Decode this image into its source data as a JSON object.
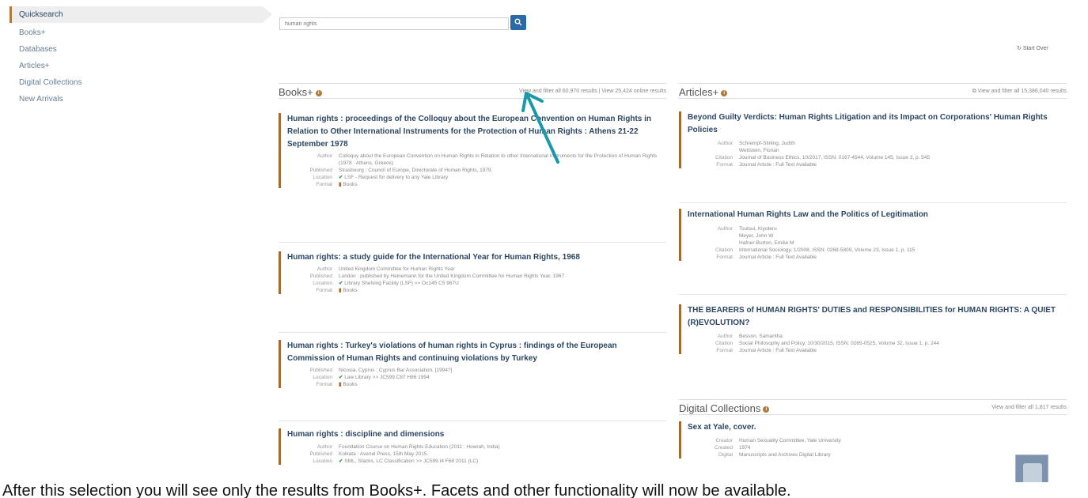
{
  "sidebar": {
    "items": [
      {
        "label": "Quicksearch"
      },
      {
        "label": "Books+"
      },
      {
        "label": "Databases"
      },
      {
        "label": "Articles+"
      },
      {
        "label": "Digital Collections"
      },
      {
        "label": "New Arrivals"
      }
    ]
  },
  "search": {
    "value": "human rights"
  },
  "start_over": "Start Over",
  "books": {
    "title": "Books+",
    "link": "View and filter all 60,970 results | View 25,424 online results",
    "records": [
      {
        "title": "Human rights : proceedings of the Colloquy about the European Convention on Human Rights in Relation to Other International Instruments for the Protection of Human Rights : Athens 21-22 September 1978",
        "author": "Colloquy about the European Convention on Human Rights in Relation to other International Instruments for the Protection of Human Rights (1978 : Athens, Greece)",
        "published": "Strasbourg : Council of Europe, Directorate of Human Rights, 1979.",
        "location": "LSF - Request for delivery to any Yale Library",
        "format": "Books"
      },
      {
        "title": "Human rights: a study guide for the International Year for Human Rights, 1968",
        "author": "United Kingdom Committee for Human Rights Year",
        "published": "London : published by Heinemann for the United Kingdom Committee for Human Rights Year, 1967.",
        "location": "Library Shelving Facility (LSF) >> Oc145 C5 967U",
        "format": "Books"
      },
      {
        "title": "Human rights : Turkey's violations of human rights in Cyprus : findings of the European Commission of Human Rights and continuing violations by Turkey",
        "published": "Nicosia, Cyprus : Cyprus Bar Association, [1994?]",
        "location": "Law Library >> JC599.C87 H86 1994",
        "format": "Books"
      },
      {
        "title": "Human rights : discipline and dimensions",
        "author": "Foundation Course on Human Rights Education (2011 : Howrah, India)",
        "published": "Kolkata : Avenel Press, 15th May 2015.",
        "location": "SML, Stacks, LC Classification >> JC599.I4 F68 2011 (LC)"
      }
    ]
  },
  "articles": {
    "title": "Articles+",
    "link": "View and filter all 15,386,040 results",
    "records": [
      {
        "title": "Beyond Guilty Verdicts: Human Rights Litigation and its Impact on Corporations' Human Rights Policies",
        "author1": "Schrempf-Stirling, Judith",
        "author2": "Wettstein, Florian",
        "citation": "Journal of Business Ethics, 10/2017, ISSN: 0167-4544, Volume 145, Issue 3, p. 545",
        "format": "Journal Article : Full Text Available"
      },
      {
        "title": "International Human Rights Law and the Politics of Legitimation",
        "author1": "Tsutsui, Kiyoteru",
        "author2": "Meyer, John W",
        "author3": "Hafner-Burton, Emilie M",
        "citation": "International Sociology, 1/2008, ISSN: 0268-5809, Volume 23, Issue 1, p. 115",
        "format": "Journal Article : Full Text Available"
      },
      {
        "title": "THE BEARERS of HUMAN RIGHTS' DUTIES and RESPONSIBILITIES for HUMAN RIGHTS: A QUIET (R)EVOLUTION?",
        "author1": "Besson, Samantha",
        "citation": "Social Philosophy and Policy, 10/30/2015, ISSN: 0265-0525, Volume 32, Issue 1, p. 244",
        "format": "Journal Article : Full Text Available"
      }
    ]
  },
  "digital": {
    "title": "Digital Collections",
    "link": "View and filter all 1,817 results",
    "records": [
      {
        "title": "Sex at Yale, cover.",
        "creator": "Human Sexuality Committee, Yale University",
        "created": "1974",
        "digital": "Manuscripts and Archives Digital Library"
      }
    ]
  },
  "labels": {
    "author": "Author",
    "published": "Published",
    "location": "Location",
    "format": "Format",
    "citation": "Citation",
    "creator": "Creator",
    "created": "Created",
    "digital": "Digital"
  },
  "caption": "After this selection you will see only the results from Books+.  Facets and other functionality will now be available."
}
